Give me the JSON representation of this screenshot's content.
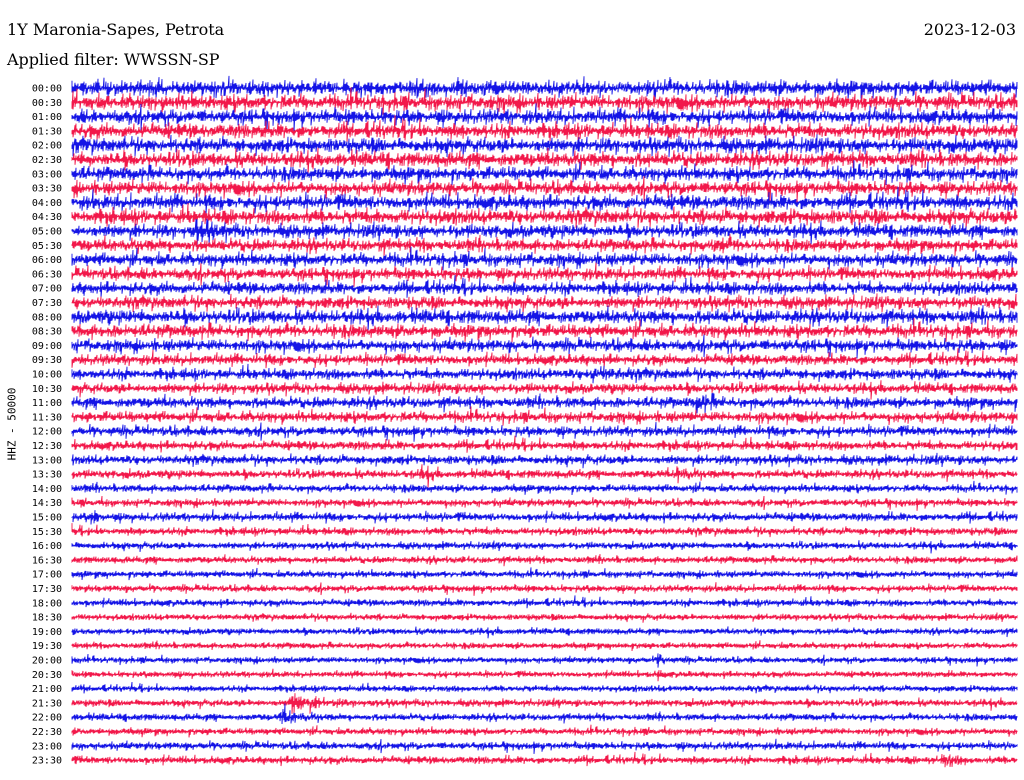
{
  "header": {
    "station": "1Y Maronia-Sapes, Petrota",
    "date": "2023-12-03",
    "filter": "Applied filter: WWSSN-SP",
    "channel_label": "HHZ - 50000"
  },
  "colors": {
    "trace_a": "#1414e6",
    "trace_b": "#f2184a",
    "background": "#ffffff"
  },
  "chart_data": {
    "type": "helicorder",
    "title": "1Y Maronia-Sapes, Petrota",
    "ylabel": "HHZ - 50000",
    "row_interval_minutes": 30,
    "trace_color_sequence": [
      "blue",
      "red"
    ],
    "row_labels": [
      "00:00",
      "00:30",
      "01:00",
      "01:30",
      "02:00",
      "02:30",
      "03:00",
      "03:30",
      "04:00",
      "04:30",
      "05:00",
      "05:30",
      "06:00",
      "06:30",
      "07:00",
      "07:30",
      "08:00",
      "08:30",
      "09:00",
      "09:30",
      "10:00",
      "10:30",
      "11:00",
      "11:30",
      "12:00",
      "12:30",
      "13:00",
      "13:30",
      "14:00",
      "14:30",
      "15:00",
      "15:30",
      "16:00",
      "16:30",
      "17:00",
      "17:30",
      "18:00",
      "18:30",
      "19:00",
      "19:30",
      "20:00",
      "20:30",
      "21:00",
      "21:30",
      "22:00",
      "22:30",
      "23:00",
      "23:30"
    ],
    "relative_noise_amplitude": [
      1.0,
      1.0,
      0.95,
      0.95,
      0.95,
      0.95,
      0.9,
      0.9,
      0.95,
      0.95,
      0.85,
      0.8,
      0.85,
      0.8,
      0.8,
      0.8,
      0.9,
      0.85,
      0.8,
      0.7,
      0.7,
      0.65,
      0.7,
      0.7,
      0.65,
      0.6,
      0.6,
      0.55,
      0.5,
      0.5,
      0.55,
      0.5,
      0.45,
      0.45,
      0.45,
      0.45,
      0.45,
      0.4,
      0.4,
      0.4,
      0.4,
      0.4,
      0.4,
      0.45,
      0.45,
      0.45,
      0.5,
      0.5
    ],
    "events": [
      {
        "row": 43,
        "start_fraction": 0.23,
        "duration_fraction": 0.06,
        "strength": 3.2
      },
      {
        "row": 44,
        "start_fraction": 0.22,
        "duration_fraction": 0.05,
        "strength": 2.0
      },
      {
        "row": 40,
        "start_fraction": 0.62,
        "duration_fraction": 0.012,
        "strength": 3.0
      },
      {
        "row": 41,
        "start_fraction": 0.62,
        "duration_fraction": 0.008,
        "strength": 1.8
      },
      {
        "row": 10,
        "start_fraction": 0.13,
        "duration_fraction": 0.04,
        "strength": 1.6
      },
      {
        "row": 11,
        "start_fraction": 0.68,
        "duration_fraction": 0.03,
        "strength": 1.3
      },
      {
        "row": 20,
        "start_fraction": 0.55,
        "duration_fraction": 0.05,
        "strength": 1.3
      },
      {
        "row": 22,
        "start_fraction": 0.66,
        "duration_fraction": 0.04,
        "strength": 1.4
      },
      {
        "row": 27,
        "start_fraction": 0.37,
        "duration_fraction": 0.02,
        "strength": 1.5
      },
      {
        "row": 27,
        "start_fraction": 0.64,
        "duration_fraction": 0.03,
        "strength": 1.6
      },
      {
        "row": 30,
        "start_fraction": 0.02,
        "duration_fraction": 0.02,
        "strength": 1.4
      },
      {
        "row": 47,
        "start_fraction": 0.92,
        "duration_fraction": 0.03,
        "strength": 1.8
      }
    ]
  }
}
